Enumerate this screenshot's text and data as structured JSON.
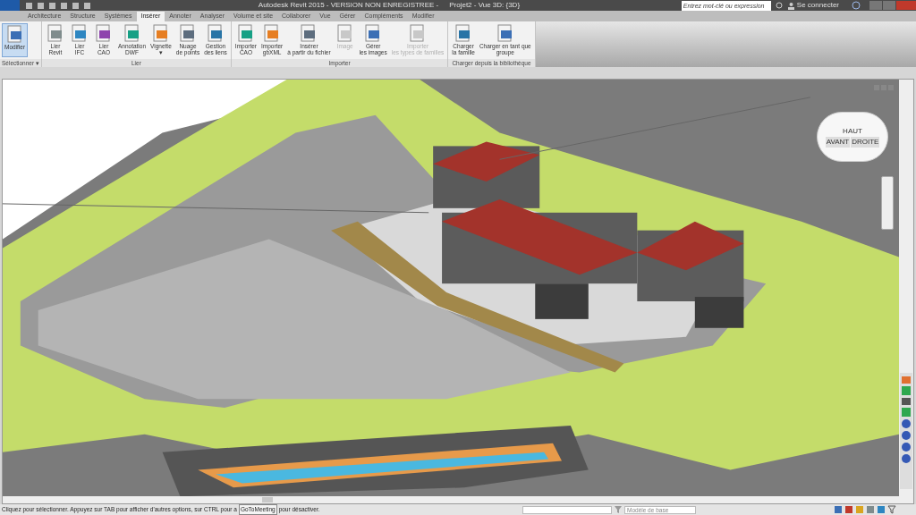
{
  "window": {
    "title": "Autodesk Revit 2015 - VERSION NON ENREGISTREE -",
    "view_title": "Projet2 - Vue 3D: {3D}"
  },
  "search": {
    "placeholder": "Entrez mot-clé ou expression"
  },
  "sign_in": "Se connecter",
  "tabs": [
    {
      "label": "Architecture",
      "selected": false
    },
    {
      "label": "Structure",
      "selected": false
    },
    {
      "label": "Systèmes",
      "selected": false
    },
    {
      "label": "Insérer",
      "selected": true
    },
    {
      "label": "Annoter",
      "selected": false
    },
    {
      "label": "Analyser",
      "selected": false
    },
    {
      "label": "Volume et site",
      "selected": false
    },
    {
      "label": "Collaborer",
      "selected": false
    },
    {
      "label": "Vue",
      "selected": false
    },
    {
      "label": "Gérer",
      "selected": false
    },
    {
      "label": "Compléments",
      "selected": false
    },
    {
      "label": "Modifier",
      "selected": false
    }
  ],
  "panels": [
    {
      "title": "Sélectionner ▾",
      "buttons": [
        {
          "label": "Modifier",
          "selected": true,
          "disabled": false
        }
      ]
    },
    {
      "title": "Lier",
      "buttons": [
        {
          "label": "Lier\nRevit",
          "selected": false,
          "disabled": false
        },
        {
          "label": "Lier\nIFC",
          "selected": false,
          "disabled": false
        },
        {
          "label": "Lier\nCAO",
          "selected": false,
          "disabled": false
        },
        {
          "label": "Annotation\nDWF",
          "selected": false,
          "disabled": false
        },
        {
          "label": "Vignette\n▾",
          "selected": false,
          "disabled": false
        },
        {
          "label": "Nuage\nde points",
          "selected": false,
          "disabled": false
        },
        {
          "label": "Gestion\ndes liens",
          "selected": false,
          "disabled": false
        }
      ]
    },
    {
      "title": "Importer",
      "buttons": [
        {
          "label": "Importer\nCAO",
          "selected": false,
          "disabled": false
        },
        {
          "label": "Importer\ngbXML",
          "selected": false,
          "disabled": false
        },
        {
          "label": "Insérer\nà partir du fichier",
          "selected": false,
          "disabled": false
        },
        {
          "label": "Image",
          "selected": false,
          "disabled": true
        },
        {
          "label": "Gérer\nles images",
          "selected": false,
          "disabled": false
        },
        {
          "label": "Importer\nles types de familles",
          "selected": false,
          "disabled": true
        }
      ]
    },
    {
      "title": "Charger depuis la bibliothèque",
      "buttons": [
        {
          "label": "Charger\nla famille",
          "selected": false,
          "disabled": false
        },
        {
          "label": "Charger en tant que\ngroupe",
          "selected": false,
          "disabled": false
        }
      ]
    }
  ],
  "view_cube": {
    "top": "HAUT",
    "front": "AVANT",
    "right": "DROITE"
  },
  "status_bar": {
    "message": "Cliquez pour sélectionner. Appuyez sur TAB pour afficher d'autres options, sur CTRL pour a",
    "tooltip": "GoToMeeting",
    "message_end": "pour désactiver.",
    "workset": "Modèle de base"
  }
}
